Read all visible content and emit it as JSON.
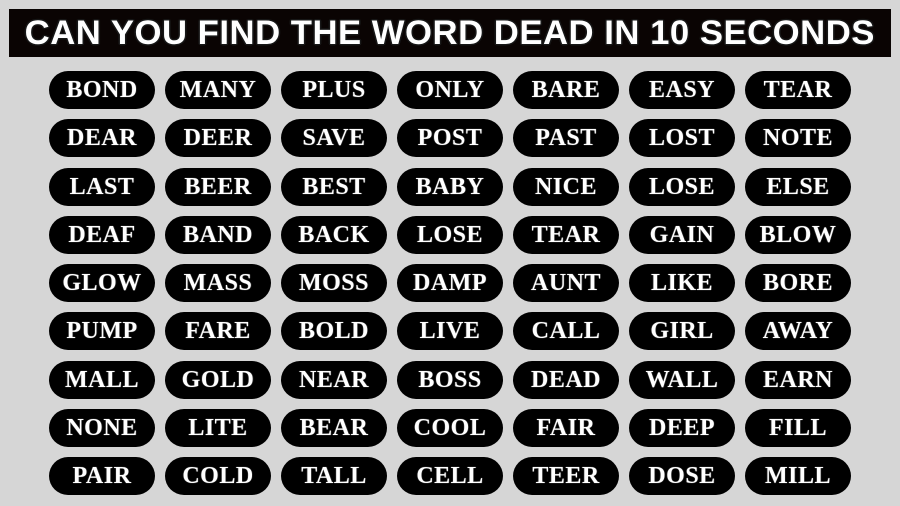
{
  "banner": {
    "title": "CAN YOU FIND THE WORD DEAD IN 10 SECONDS",
    "background_color": "#0a0403",
    "text_color": "#ffffff"
  },
  "page": {
    "background_color": "#d6d6d6"
  },
  "puzzle": {
    "target_word": "DEAD",
    "time_limit_seconds": "10",
    "columns": 7,
    "rows": 9,
    "pill_color": "#000000",
    "word_color": "#ffffff",
    "grid": [
      [
        "BOND",
        "MANY",
        "PLUS",
        "ONLY",
        "BARE",
        "EASY",
        "TEAR"
      ],
      [
        "DEAR",
        "DEER",
        "SAVE",
        "POST",
        "PAST",
        "LOST",
        "NOTE"
      ],
      [
        "LAST",
        "BEER",
        "BEST",
        "BABY",
        "NICE",
        "LOSE",
        "ELSE"
      ],
      [
        "DEAF",
        "BAND",
        "BACK",
        "LOSE",
        "TEAR",
        "GAIN",
        "BLOW"
      ],
      [
        "GLOW",
        "MASS",
        "MOSS",
        "DAMP",
        "AUNT",
        "LIKE",
        "BORE"
      ],
      [
        "PUMP",
        "FARE",
        "BOLD",
        "LIVE",
        "CALL",
        "GIRL",
        "AWAY"
      ],
      [
        "MALL",
        "GOLD",
        "NEAR",
        "BOSS",
        "DEAD",
        "WALL",
        "EARN"
      ],
      [
        "NONE",
        "LITE",
        "BEAR",
        "COOL",
        "FAIR",
        "DEEP",
        "FILL"
      ],
      [
        "PAIR",
        "COLD",
        "TALL",
        "CELL",
        "TEER",
        "DOSE",
        "MILL"
      ]
    ]
  }
}
